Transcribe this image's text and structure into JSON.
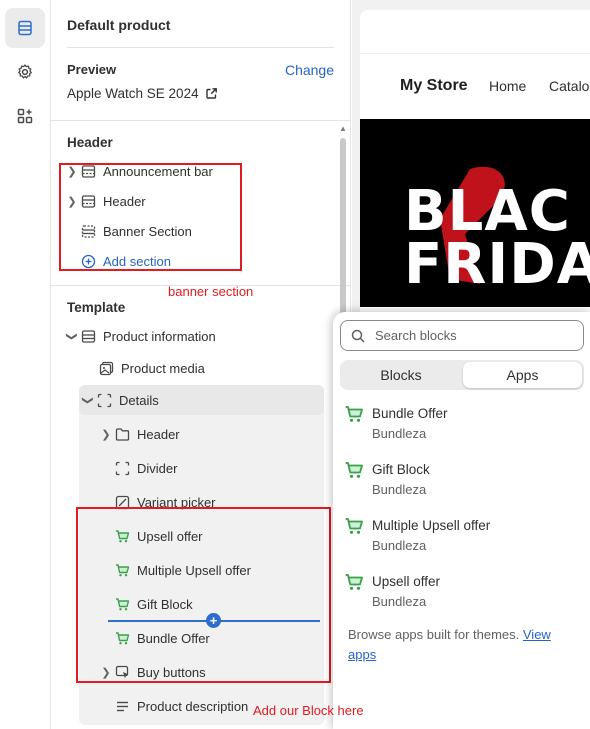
{
  "rail": {
    "items": [
      {
        "name": "sections-icon",
        "active": true
      },
      {
        "name": "settings-icon",
        "active": false
      },
      {
        "name": "apps-icon",
        "active": false
      }
    ]
  },
  "sidebar": {
    "title": "Default product",
    "preview": {
      "label": "Preview",
      "change": "Change",
      "product": "Apple Watch SE 2024"
    },
    "header_group": {
      "title": "Header",
      "items": [
        {
          "label": "Announcement bar",
          "icon": "section-icon",
          "expandable": true
        },
        {
          "label": "Header",
          "icon": "section-icon",
          "expandable": true
        },
        {
          "label": "Banner Section",
          "icon": "section-icon",
          "expandable": false
        }
      ],
      "add_section": "Add section"
    },
    "template_group": {
      "title": "Template",
      "product_information": "Product information",
      "product_media": "Product media",
      "details": "Details",
      "details_children": [
        {
          "label": "Header",
          "icon": "folder-icon",
          "expandable": true
        },
        {
          "label": "Divider",
          "icon": "divider-icon",
          "expandable": false
        },
        {
          "label": "Variant picker",
          "icon": "variant-icon",
          "expandable": false
        },
        {
          "label": "Upsell offer",
          "icon": "cart-app-icon",
          "expandable": false
        },
        {
          "label": "Multiple Upsell offer",
          "icon": "cart-app-icon",
          "expandable": false
        },
        {
          "label": "Gift Block",
          "icon": "cart-app-icon",
          "expandable": false
        },
        {
          "label": "Bundle Offer",
          "icon": "cart-app-icon",
          "expandable": false
        },
        {
          "label": "Buy buttons",
          "icon": "buy-buttons-icon",
          "expandable": true
        },
        {
          "label": "Product description",
          "icon": "text-lines-icon",
          "expandable": false
        }
      ]
    }
  },
  "annotations": {
    "banner_note": "banner section",
    "block_note": "Add our Block here",
    "color": "#e01b22"
  },
  "store_preview": {
    "store_name": "My Store",
    "nav": [
      "Home",
      "Catalo"
    ],
    "banner_lines": [
      "BLAC",
      "FRIDA"
    ]
  },
  "popover": {
    "search_placeholder": "Search blocks",
    "tabs": [
      {
        "label": "Blocks",
        "active": false
      },
      {
        "label": "Apps",
        "active": true
      }
    ],
    "apps": [
      {
        "name": "Bundle Offer",
        "vendor": "Bundleza"
      },
      {
        "name": "Gift Block",
        "vendor": "Bundleza"
      },
      {
        "name": "Multiple Upsell offer",
        "vendor": "Bundleza"
      },
      {
        "name": "Upsell offer",
        "vendor": "Bundleza"
      }
    ],
    "browse_text": "Browse apps built for themes.",
    "browse_link": "View apps"
  },
  "colors": {
    "link_blue": "#2563c9",
    "app_green": "#3aa14a",
    "insert_blue": "#2c6ecb"
  }
}
